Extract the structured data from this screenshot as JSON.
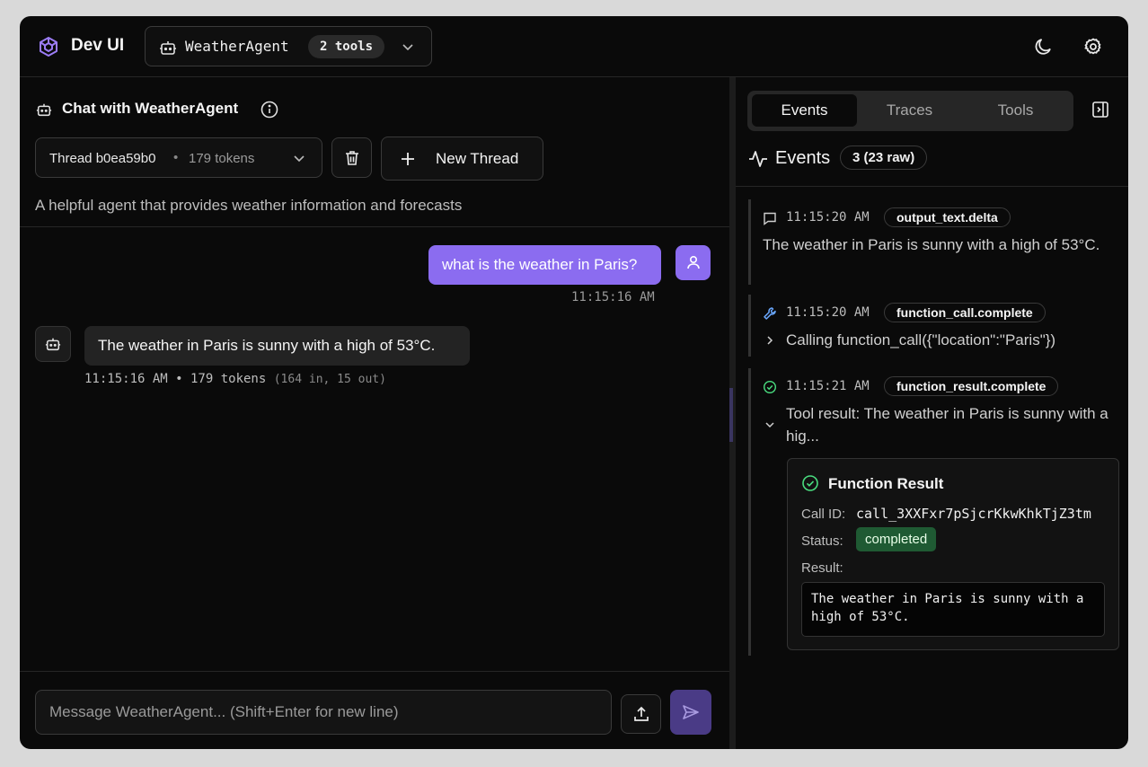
{
  "header": {
    "app_title": "Dev UI",
    "agent_name": "WeatherAgent",
    "tools_badge": "2 tools"
  },
  "chat": {
    "title": "Chat with WeatherAgent",
    "thread_label": "Thread b0ea59b0",
    "thread_separator": "•",
    "thread_tokens": "179 tokens",
    "new_thread_label": "New Thread",
    "agent_description": "A helpful agent that provides weather information and forecasts",
    "messages": [
      {
        "role": "user",
        "text": "what is the weather in Paris?",
        "time": "11:15:16 AM"
      },
      {
        "role": "assistant",
        "text": "The weather in Paris is sunny with a high of 53°C.",
        "meta": "11:15:16 AM • 179 tokens",
        "meta_detail": "(164 in, 15 out)"
      }
    ],
    "composer_placeholder": "Message WeatherAgent... (Shift+Enter for new line)"
  },
  "right_panel": {
    "tabs": [
      "Events",
      "Traces",
      "Tools"
    ],
    "active_tab": "Events",
    "events_title": "Events",
    "events_count": "3 (23 raw)",
    "events": [
      {
        "icon": "message-icon",
        "time": "11:15:20 AM",
        "type": "output_text.delta",
        "text": "The weather in Paris is sunny with a high of 53°C."
      },
      {
        "icon": "wrench-icon",
        "time": "11:15:20 AM",
        "type": "function_call.complete",
        "text": "Calling function_call({\"location\":\"Paris\"})"
      },
      {
        "icon": "check-circle-icon",
        "time": "11:15:21 AM",
        "type": "function_result.complete",
        "text": "Tool result: The weather in Paris is sunny with a hig..."
      }
    ],
    "function_result": {
      "title": "Function Result",
      "call_id_label": "Call ID:",
      "call_id": "call_3XXFxr7pSjcrKkwKhkTjZ3tm",
      "status_label": "Status:",
      "status": "completed",
      "result_label": "Result:",
      "result": "The weather in Paris is sunny with a high of 53°C."
    }
  },
  "colors": {
    "accent": "#8b6cf0",
    "background": "#0a0a0a",
    "success": "#1f5a33"
  }
}
